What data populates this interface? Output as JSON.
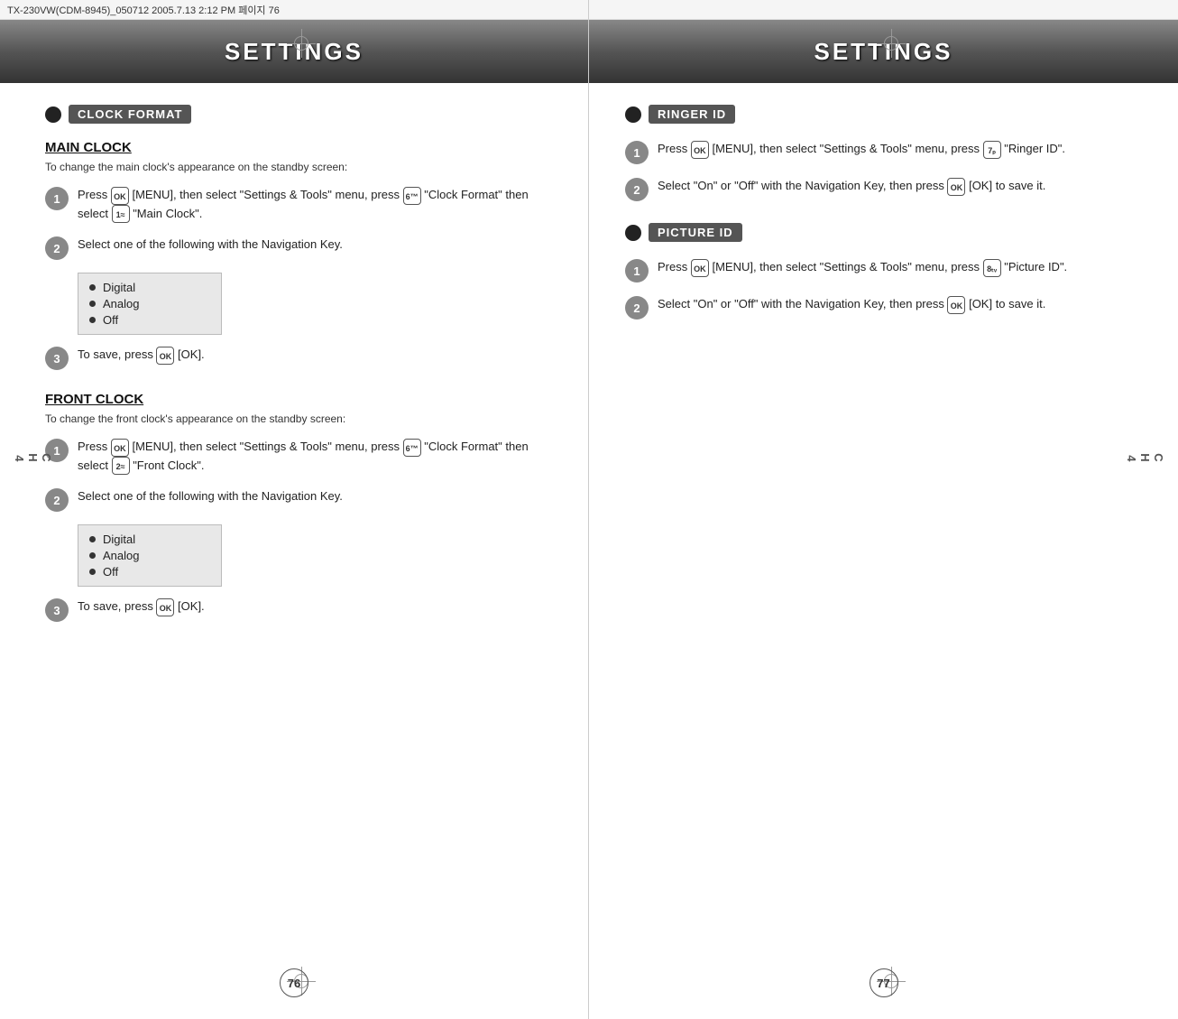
{
  "left": {
    "file_info": "TX-230VW(CDM-8945)_050712  2005.7.13  2:12 PM  페이지 76",
    "header_title": "SETTINGS",
    "section1": {
      "label": "CLOCK FORMAT",
      "sub1": {
        "heading": "MAIN CLOCK",
        "description": "To change the main clock's appearance on the standby screen:",
        "steps": [
          {
            "number": "1",
            "text": "Press [MENU], then select \"Settings & Tools\" menu, press  \"Clock Format\" then select  \"Main Clock\"."
          },
          {
            "number": "2",
            "text": "Select one of the following with the Navigation Key."
          },
          {
            "number": "3",
            "text": "To save, press  [OK]."
          }
        ],
        "options": [
          "Digital",
          "Analog",
          "Off"
        ]
      },
      "sub2": {
        "heading": "FRONT CLOCK",
        "description": "To change the front clock's appearance on the standby screen:",
        "steps": [
          {
            "number": "1",
            "text": "Press [MENU], then select \"Settings & Tools\" menu, press  \"Clock Format\" then select  \"Front Clock\"."
          },
          {
            "number": "2",
            "text": "Select one of the following with the Navigation Key."
          },
          {
            "number": "3",
            "text": "To save, press  [OK]."
          }
        ],
        "options": [
          "Digital",
          "Analog",
          "Off"
        ]
      }
    },
    "ch_label": "CH\n4",
    "page_number": "76"
  },
  "right": {
    "header_title": "SETTINGS",
    "section1": {
      "label": "RINGER ID",
      "steps": [
        {
          "number": "1",
          "text": "Press [MENU], then select \"Settings & Tools\" menu, press  \"Ringer ID\"."
        },
        {
          "number": "2",
          "text": "Select \"On\" or \"Off\" with the Navigation Key, then press  [OK] to save it."
        }
      ]
    },
    "section2": {
      "label": "PICTURE ID",
      "steps": [
        {
          "number": "1",
          "text": "Press [MENU], then select \"Settings & Tools\" menu, press  \"Picture ID\"."
        },
        {
          "number": "2",
          "text": "Select \"On\" or \"Off\" with the Navigation Key, then press  [OK] to save it."
        }
      ]
    },
    "ch_label": "CH\n4",
    "page_number": "77"
  }
}
